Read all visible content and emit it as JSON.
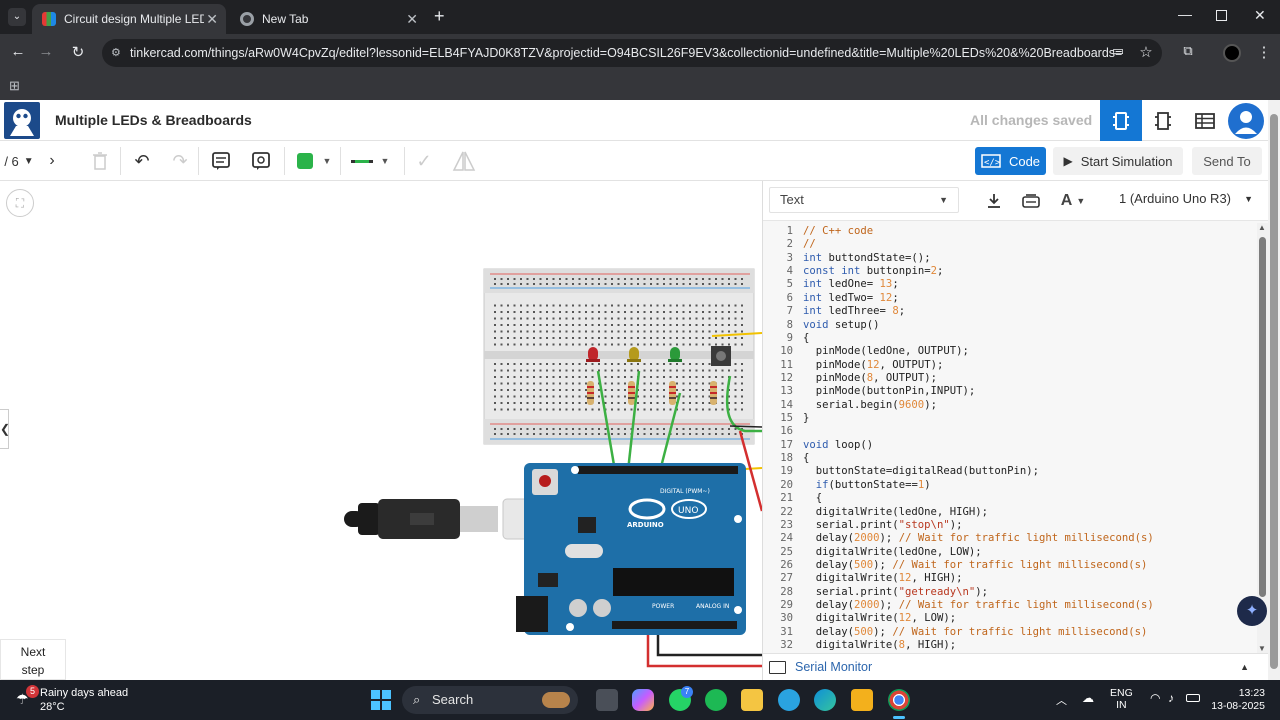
{
  "browser": {
    "tabs": [
      {
        "title": "Circuit design Multiple LEDs & |",
        "active": true
      },
      {
        "title": "New Tab",
        "active": false
      }
    ],
    "url": "tinkercad.com/things/aRw0W4CpvZq/editel?lessonid=ELB4FYAJD0K8TZV&projectid=O94BCSIL26F9EV3&collectionid=undefined&title=Multiple%20LEDs%20&%20Breadboards="
  },
  "header": {
    "project_title": "Multiple LEDs & Breadboards",
    "save_status": "All changes saved"
  },
  "toolbar": {
    "step_indicator": "/ 6",
    "code_label": "Code",
    "start_sim_label": "Start Simulation",
    "send_to_label": "Send To",
    "color_swatch": "#2bb34a"
  },
  "canvas": {
    "next_step_label": "Next step"
  },
  "code_panel": {
    "mode": "Text",
    "device": "1 (Arduino Uno R3)",
    "serial_monitor_label": "Serial Monitor",
    "lines": [
      "// C++ code",
      "//",
      "int buttondState=();",
      "const int buttonpin=2;",
      "int ledOne= 13;",
      "int ledTwo= 12;",
      "int ledThree= 8;",
      "void setup()",
      "{",
      "  pinMode(ledOne, OUTPUT);",
      "  pinMode(12, OUTPUT);",
      "  pinMode(8, OUTPUT);",
      "  pinMode(buttonPin,INPUT);",
      "  serial.begin(9600);",
      "}",
      "",
      "void loop()",
      "{",
      "  buttonState=digitalRead(buttonPin);",
      "  if(buttonState==1)",
      "  {",
      "  digitalWrite(ledOne, HIGH);",
      "  serial.print(\"stop\\n\");",
      "  delay(2000); // Wait for traffic light millisecond(s)",
      "  digitalWrite(ledOne, LOW);",
      "  delay(500); // Wait for traffic light millisecond(s)",
      "  digitalWrite(12, HIGH);",
      "  serial.print(\"getready\\n\");",
      "  delay(2000); // Wait for traffic light millisecond(s)",
      "  digitalWrite(12, LOW);",
      "  delay(500); // Wait for traffic light millisecond(s)",
      "  digitalWrite(8, HIGH);"
    ]
  },
  "taskbar": {
    "weather_title": "Rainy days ahead",
    "weather_temp": "28°C",
    "weather_badge": "5",
    "search_label": "Search",
    "whatsapp_badge": "7",
    "lang": "ENG",
    "region": "IN",
    "time": "13:23",
    "date": "13-08-2025"
  },
  "colors": {
    "accent": "#1477d4",
    "arduino_blue": "#1e6fa8",
    "led_red": "#c0262b",
    "led_yellow": "#b59a1c",
    "led_green": "#2b9a3a",
    "wire_green": "#3cb043",
    "wire_red": "#d32f2f"
  }
}
